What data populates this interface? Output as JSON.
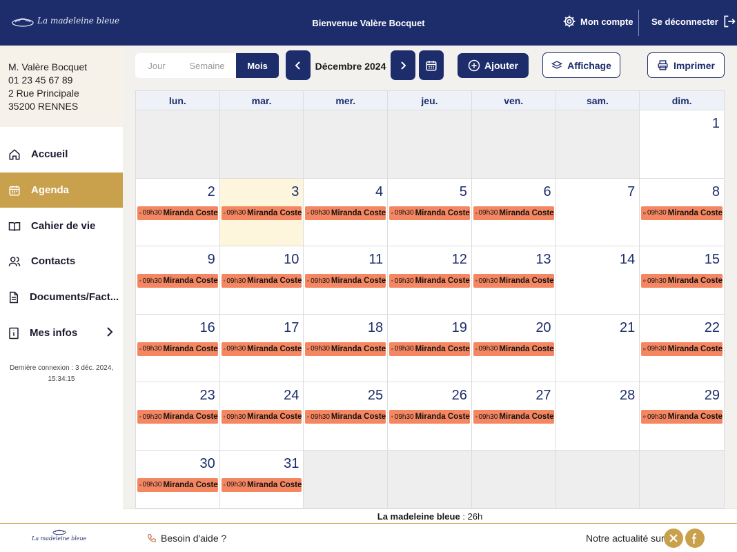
{
  "header": {
    "logo_text": "La madeleine bleue",
    "welcome": "Bienvenue Valère Bocquet",
    "account_label": "Mon compte",
    "logout_label": "Se déconnecter"
  },
  "sidebar": {
    "address": [
      "M. Valère Bocquet",
      "01 23 45 67 89",
      "2 Rue Principale",
      "35200 RENNES"
    ],
    "items": [
      {
        "label": "Accueil",
        "icon": "home-icon"
      },
      {
        "label": "Agenda",
        "icon": "calendar-icon",
        "active": true
      },
      {
        "label": "Cahier de vie",
        "icon": "book-icon"
      },
      {
        "label": "Contacts",
        "icon": "users-icon"
      },
      {
        "label": "Documents/Fact...",
        "icon": "document-icon"
      },
      {
        "label": "Mes infos",
        "icon": "info-icon"
      }
    ],
    "last_login_line1": "Dernière connexion : 3 déc. 2024,",
    "last_login_line2": "15:34:15"
  },
  "toolbar": {
    "view_tabs": [
      "Jour",
      "Semaine",
      "Mois"
    ],
    "active_view": "Mois",
    "month_label": "Décembre 2024",
    "add_label": "Ajouter",
    "display_label": "Affichage",
    "print_label": "Imprimer"
  },
  "calendar": {
    "weekdays": [
      "lun.",
      "mar.",
      "mer.",
      "jeu.",
      "ven.",
      "sam.",
      "dim."
    ],
    "leading_empty": 6,
    "trailing_empty": 5,
    "days": 31,
    "today": 3,
    "event_time": "09h30",
    "event_name": "Miranda Coste",
    "event_days": [
      2,
      3,
      4,
      5,
      6,
      8,
      9,
      10,
      11,
      12,
      13,
      15,
      16,
      17,
      18,
      19,
      20,
      22,
      23,
      24,
      25,
      26,
      27,
      29,
      30,
      31
    ]
  },
  "duration": {
    "label": "La madeleine bleue",
    "value": " : 26h"
  },
  "footer": {
    "logo_text": "La madeleine bleue",
    "help_label": "Besoin d'aide ?",
    "news_label": "Notre actualité sur",
    "social": [
      "x-icon",
      "facebook-icon"
    ]
  },
  "colors": {
    "navy": "#1d2d6b",
    "gold": "#c9a14d",
    "event": "#f48762",
    "today": "#fdf5dc"
  }
}
